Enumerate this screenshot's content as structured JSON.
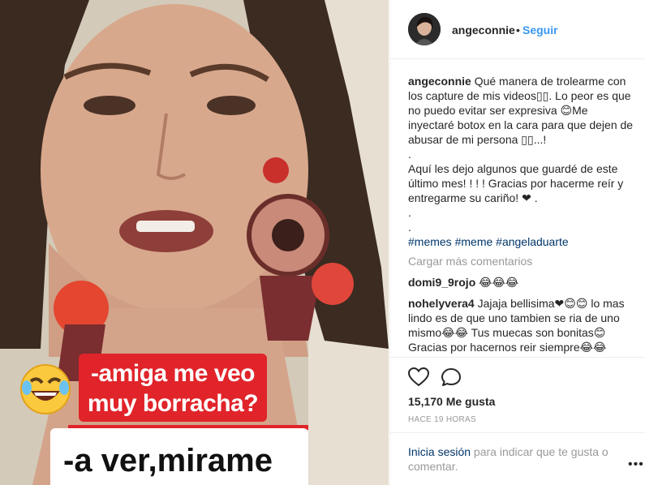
{
  "media": {
    "caption_red_line1": "-amiga me veo",
    "caption_red_line2": "muy borracha?",
    "caption_white": "-a ver,mirame",
    "emoji": "😂"
  },
  "header": {
    "username": "angeconnie",
    "separator": "•",
    "follow_label": "Seguir"
  },
  "post": {
    "author": "angeconnie",
    "caption_lines": [
      "Qué manera de trolearme con los capture de mis videos▯▯. Lo peor es que no puedo evitar ser expresiva 😊Me inyectaré botox en la cara para que dejen de abusar de mi persona ▯▯...!",
      ".",
      "Aquí les dejo algunos que guardé de este último mes! ! ! ! Gracias por hacerme reír y entregarme su cariño! ❤ .",
      ".",
      "."
    ],
    "hashtags": [
      "#memes",
      "#meme",
      "#angeladuarte"
    ],
    "load_more": "Cargar más comentarios"
  },
  "comments": [
    {
      "user": "domi9_9rojo",
      "text": "😂😂😂"
    },
    {
      "user": "nohelyvera4",
      "text": "Jajaja bellisima❤😊😊 lo mas lindo es de que uno tambien se ria de uno mismo😂😂 Tus muecas son bonitas😊 Gracias por hacernos reir siempre😂😂"
    }
  ],
  "actions": {
    "likes": "15,170 Me gusta",
    "time": "HACE 19 HORAS"
  },
  "login": {
    "link": "Inicia sesión",
    "text": " para indicar que te gusta o comentar.",
    "more": "•••"
  },
  "icons": {
    "heart": "heart-icon",
    "comment": "comment-icon",
    "options": "more-options-icon"
  }
}
